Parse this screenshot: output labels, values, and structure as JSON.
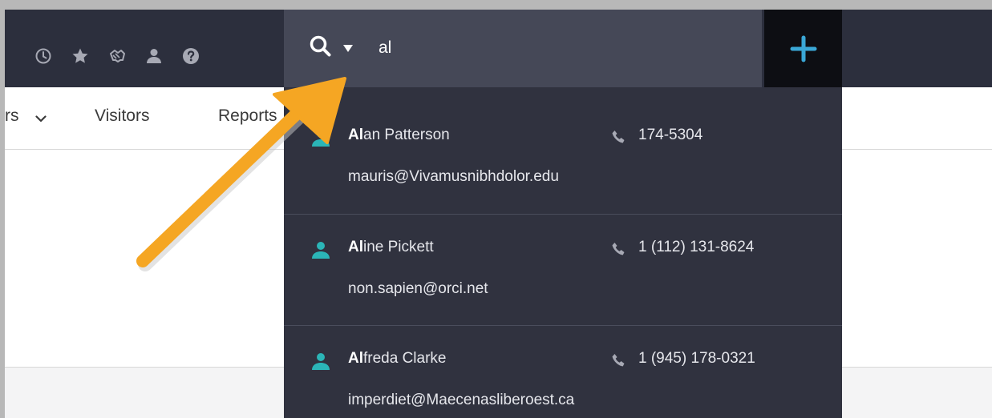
{
  "toolbar": {
    "icons": [
      "clock-icon",
      "star-icon",
      "handshake-icon",
      "user-icon",
      "help-icon"
    ]
  },
  "search": {
    "query": "al",
    "placeholder": ""
  },
  "nav": {
    "partial_item": "rs",
    "items": [
      "Visitors",
      "Reports"
    ]
  },
  "results": [
    {
      "match": "Al",
      "rest": "an Patterson",
      "phone": "174-5304",
      "email": "mauris@Vivamusnibhdolor.edu"
    },
    {
      "match": "Al",
      "rest": "ine Pickett",
      "phone": "1 (112) 131-8624",
      "email": "non.sapien@orci.net"
    },
    {
      "match": "Al",
      "rest": "freda Clarke",
      "phone": "1 (945) 178-0321",
      "email": "imperdiet@Maecenasliberoest.ca"
    }
  ],
  "colors": {
    "topbar": "#2c2f3d",
    "search_box": "#454857",
    "dropdown": "#30323f",
    "accent": "#3aa7d6",
    "person_icon": "#2bb5b7",
    "annotation_arrow": "#f5a623"
  }
}
